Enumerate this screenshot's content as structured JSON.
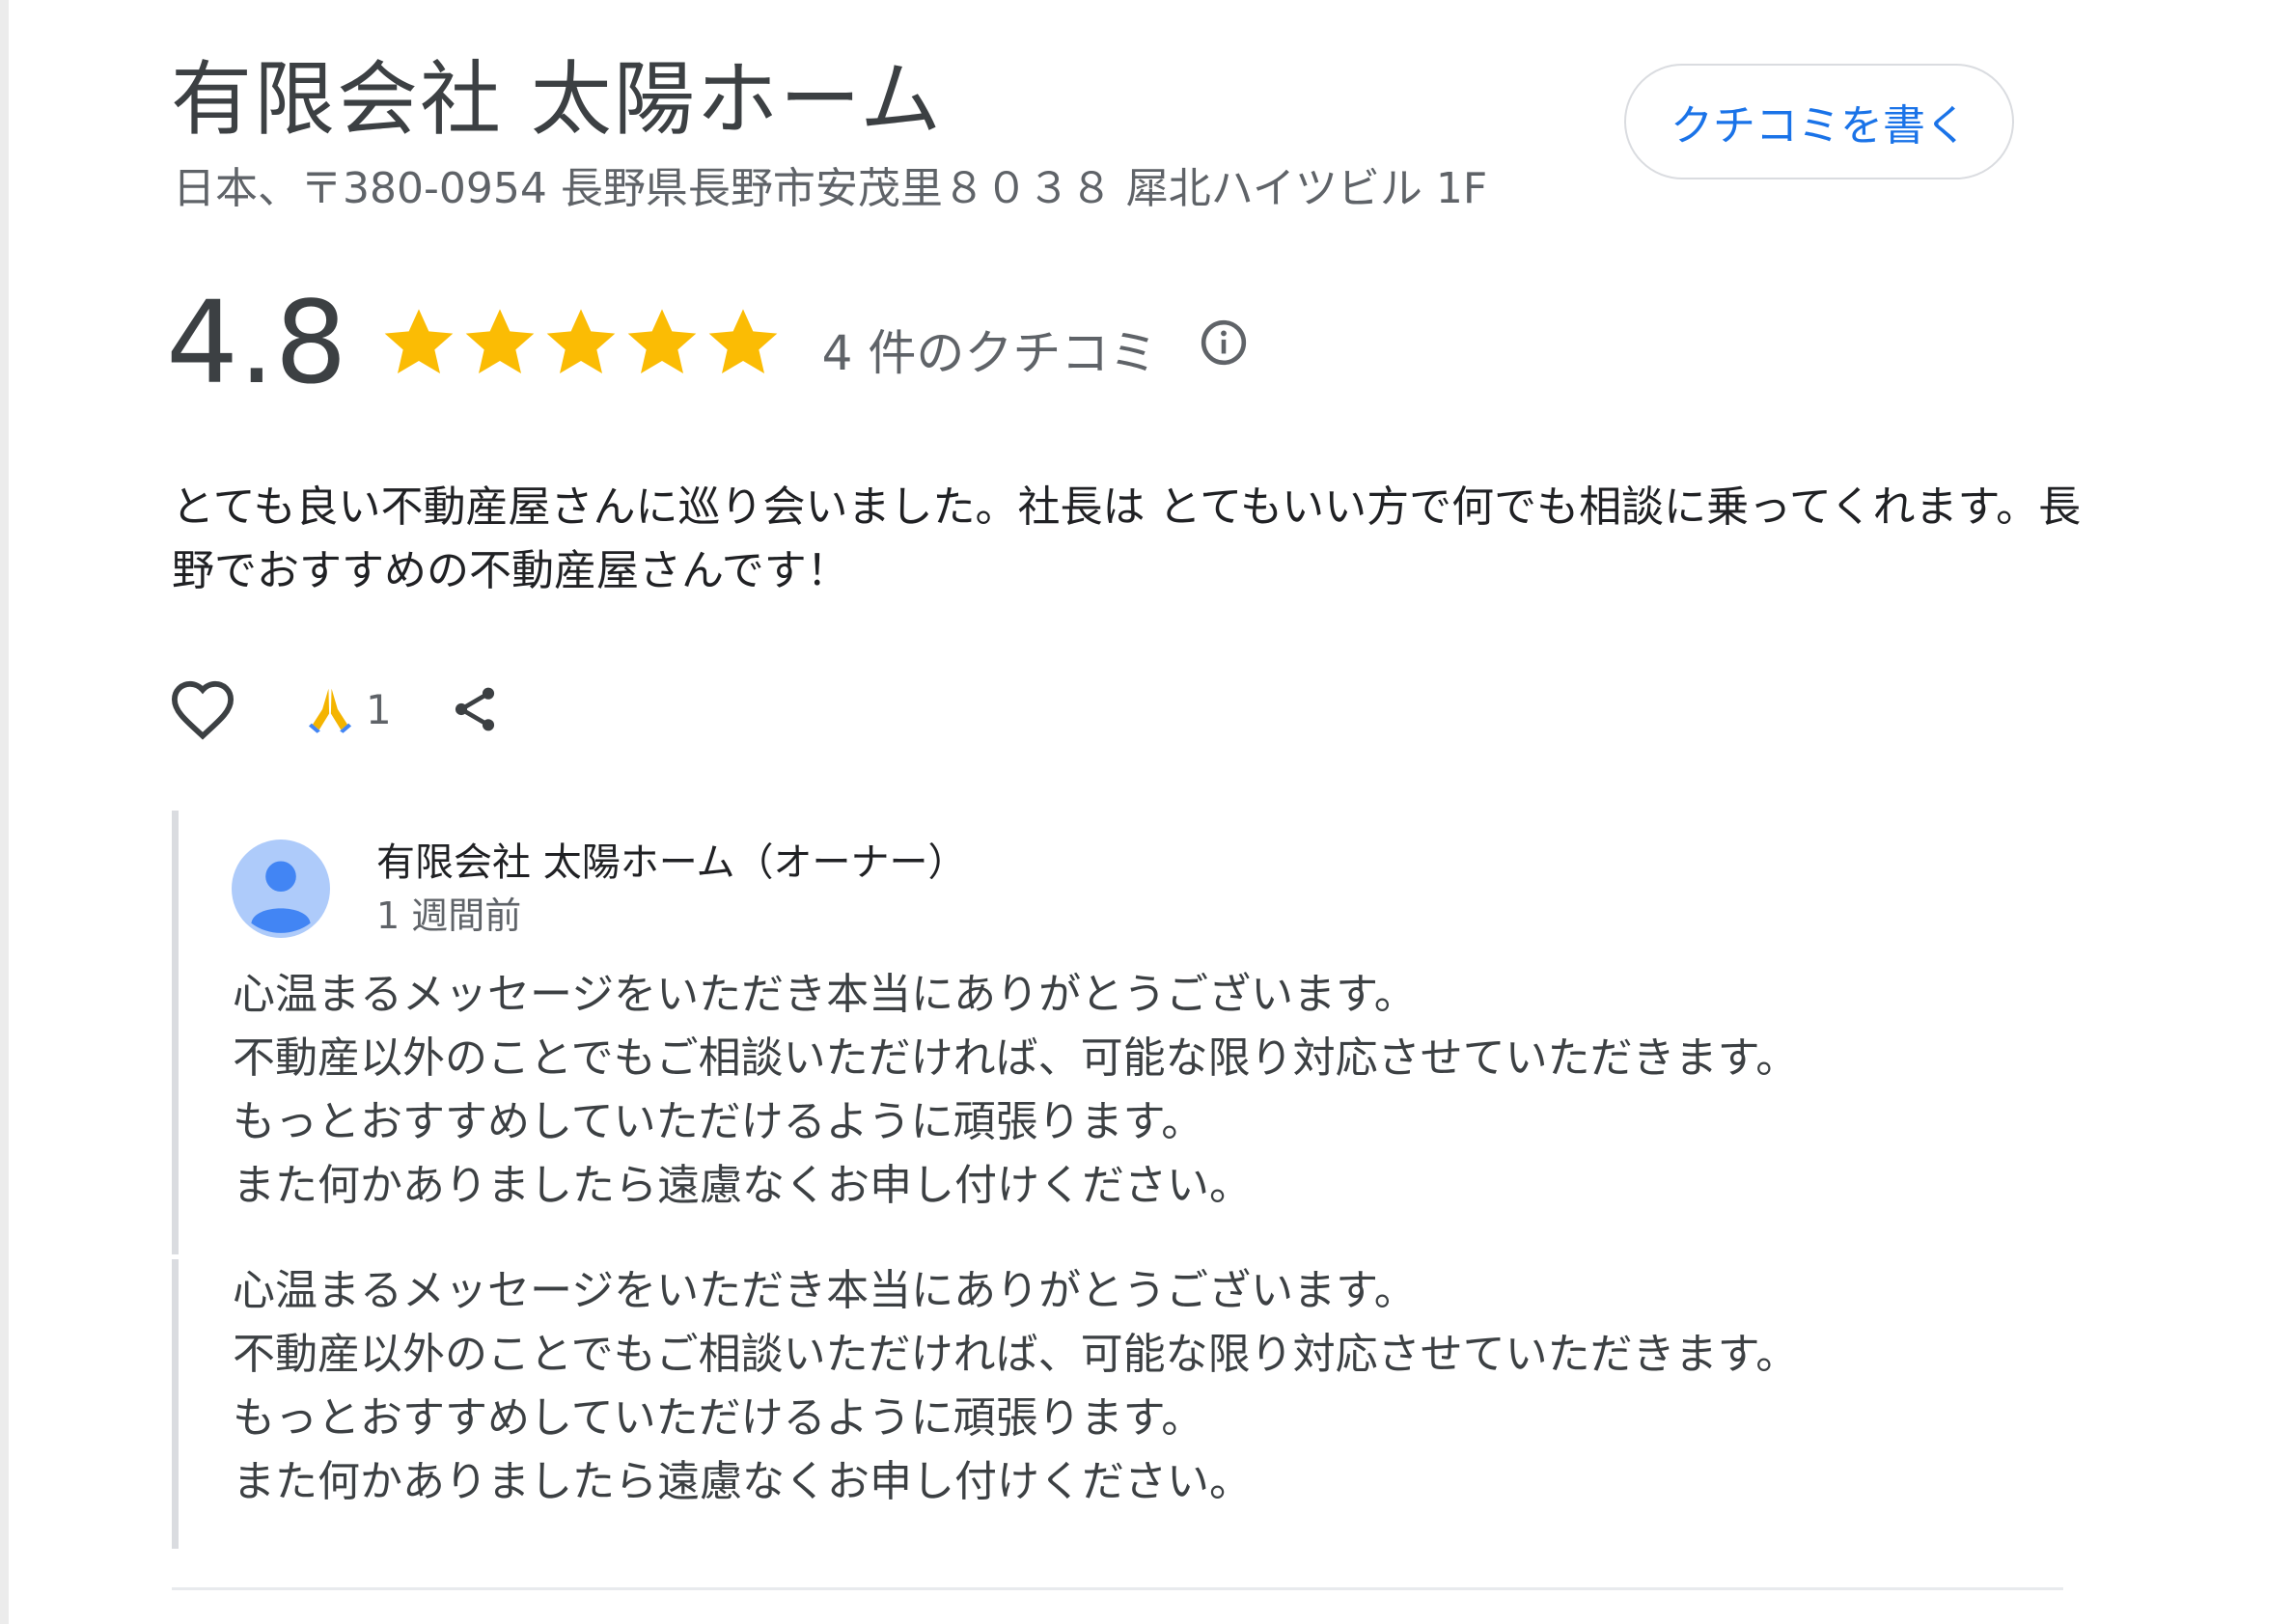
{
  "business": {
    "name": "有限会社 太陽ホーム",
    "address": "日本、〒380-0954 長野県長野市安茂里８０３８ 犀北ハイツビル 1F",
    "write_review_label": "クチコミを書く"
  },
  "rating": {
    "value": "4.8",
    "stars": 5,
    "star_color": "#fbbc04",
    "review_count": "4 件のクチコミ",
    "info_icon": "info-icon"
  },
  "review": {
    "text": "とても良い不動産屋さんに巡り会いました。社長は とてもいい方で何でも相談に乗ってくれます。長野でおすすめの不動産屋さんです！",
    "actions": {
      "like_icon": "heart-icon",
      "reaction_icon": "folded-hands-icon",
      "reaction_count": "1",
      "share_icon": "share-icon"
    }
  },
  "owner_replies": [
    {
      "name": "有限会社 太陽ホーム（オーナー）",
      "time": "1 週間前",
      "text": "心温まるメッセージをいただき本当にありがとうございます。\n不動産以外のことでもご相談いただければ、可能な限り対応させていただきます。\nもっとおすすめしていただけるように頑張ります。\nまた何かありましたら遠慮なくお申し付けください。"
    },
    {
      "text": "心温まるメッセージをいただき本当にありがとうございます。\n不動産以外のことでもご相談いただければ、可能な限り対応させていただきます。\nもっとおすすめしていただけるように頑張ります。\nまた何かありましたら遠慮なくお申し付けください。"
    }
  ],
  "colors": {
    "accent_blue": "#1a73e8",
    "avatar_bg": "#aecbfa",
    "avatar_fg": "#4285f4"
  }
}
